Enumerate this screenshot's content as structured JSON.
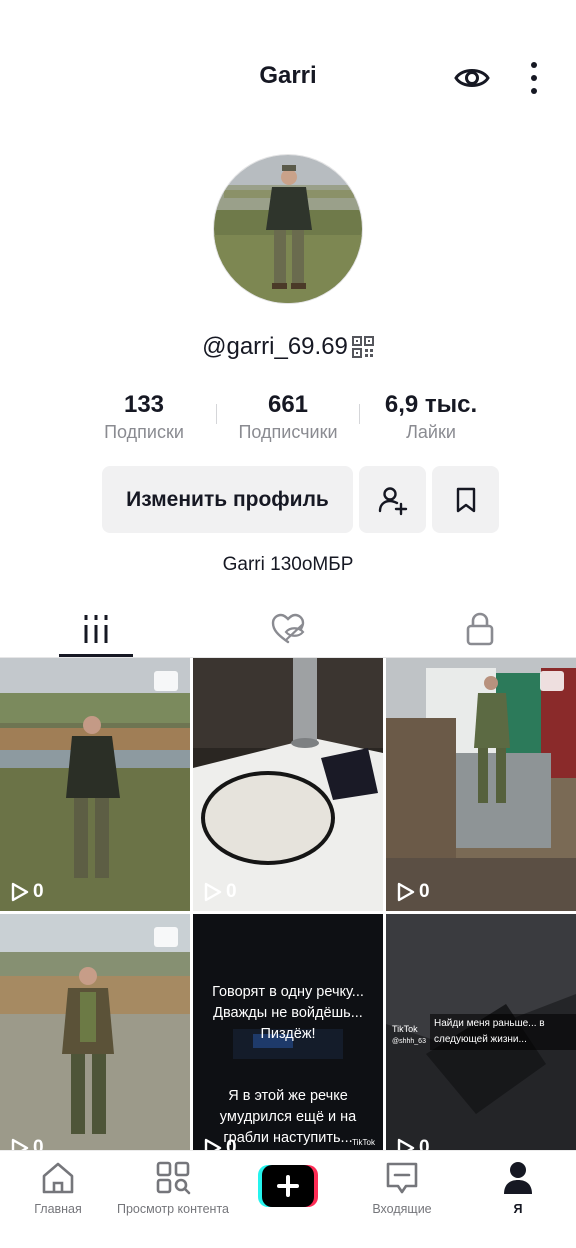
{
  "header": {
    "title": "Garri"
  },
  "profile": {
    "username": "@garri_69.69",
    "bio": "Garri 130оМБР",
    "stats": [
      {
        "value": "133",
        "label": "Подписки"
      },
      {
        "value": "661",
        "label": "Подписчики"
      },
      {
        "value": "6,9 тыс.",
        "label": "Лайки"
      }
    ],
    "edit_button": "Изменить профиль"
  },
  "tabs": [
    "videos-grid-icon",
    "liked-hidden-icon",
    "lock-icon"
  ],
  "videos": [
    {
      "views": "0",
      "is_photo": true
    },
    {
      "views": "0",
      "is_photo": false
    },
    {
      "views": "0",
      "is_photo": true
    },
    {
      "views": "0",
      "is_photo": true
    },
    {
      "views": "0",
      "is_photo": false,
      "caption_top": "Говорят в одну речку... Дважды не войдёшь... Пиздёж!",
      "caption_bottom": "Я в этой же речке умудрился ещё и на грабли наступить...",
      "watermark": "TikTok"
    },
    {
      "views": "0",
      "is_photo": false,
      "caption_top": "Найди меня раньше... в следующей жизни...",
      "watermark_user": "TikTok",
      "watermark_handle": "@shhh_63"
    }
  ],
  "nav": [
    {
      "label": "Главная",
      "icon": "home-icon"
    },
    {
      "label": "Просмотр контента",
      "icon": "content-view-icon"
    },
    {
      "label": "",
      "icon": "create-plus-icon"
    },
    {
      "label": "Входящие",
      "icon": "inbox-icon"
    },
    {
      "label": "Я",
      "icon": "profile-icon"
    }
  ]
}
